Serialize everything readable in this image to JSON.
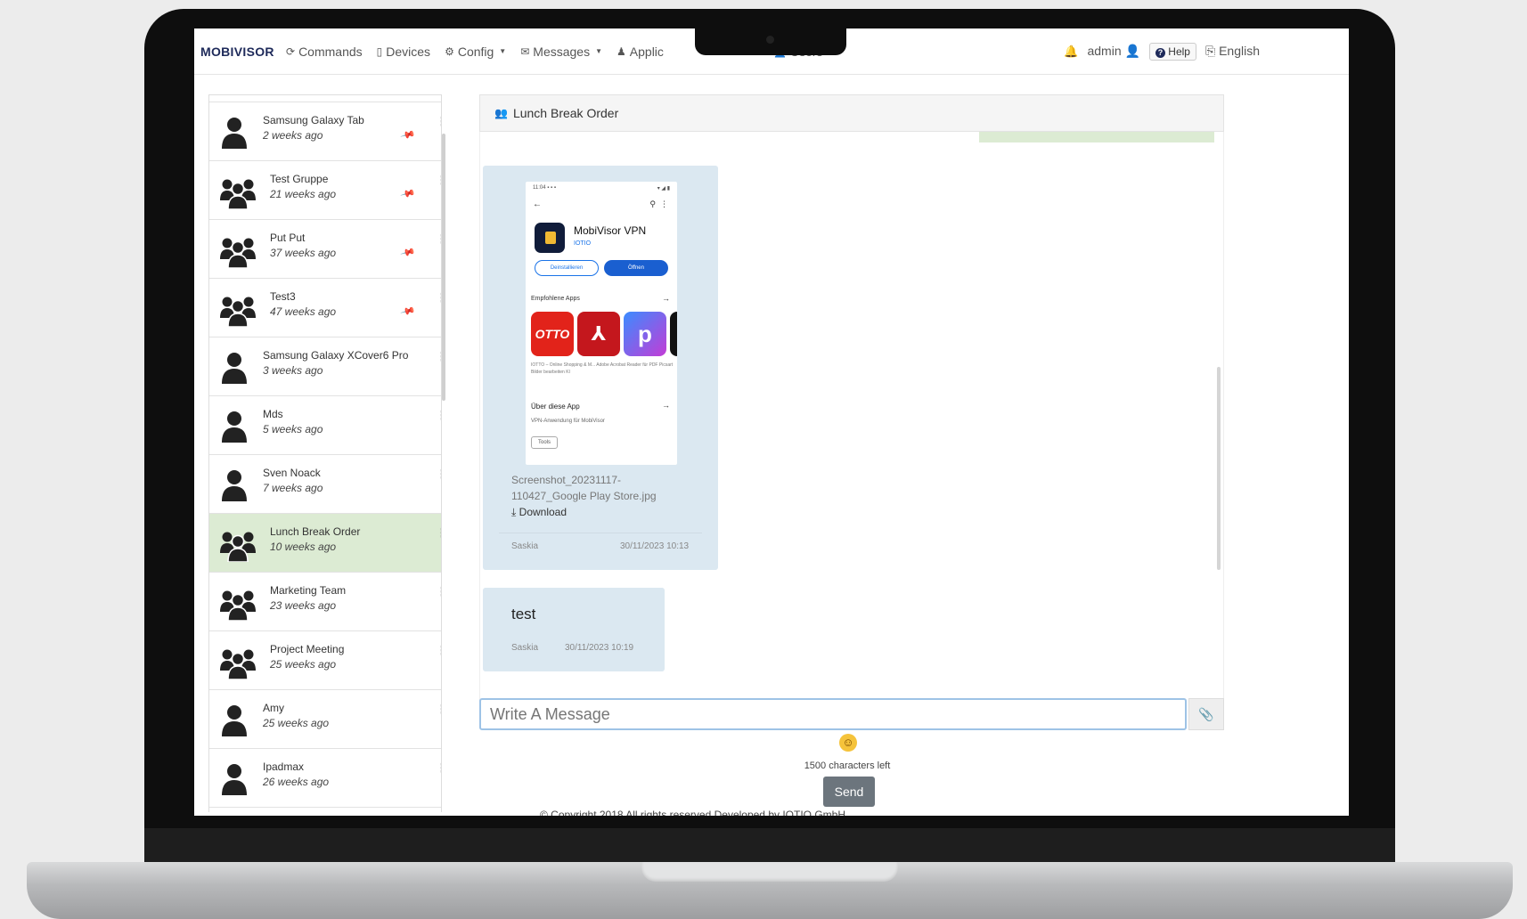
{
  "nav": {
    "brand": "MOBIVISOR",
    "items": [
      {
        "label": "Commands",
        "icon": "refresh-icon",
        "caret": false
      },
      {
        "label": "Devices",
        "icon": "phone-icon",
        "caret": false
      },
      {
        "label": "Config",
        "icon": "gear-icon",
        "caret": true
      },
      {
        "label": "Messages",
        "icon": "envelope-icon",
        "caret": true
      },
      {
        "label": "Applic",
        "icon": "app-icon",
        "caret": false
      },
      {
        "label": "Users",
        "icon": "user-icon",
        "caret": true
      }
    ],
    "admin_label": "admin",
    "help_label": "Help",
    "language_label": "English"
  },
  "conversations": [
    {
      "name": "Samsung Galaxy Tab",
      "time": "2 weeks ago",
      "type": "user",
      "pinned": true,
      "active": false
    },
    {
      "name": "Test Gruppe",
      "time": "21 weeks ago",
      "type": "group",
      "pinned": true,
      "active": false
    },
    {
      "name": "Put Put",
      "time": "37 weeks ago",
      "type": "group",
      "pinned": true,
      "active": false
    },
    {
      "name": "Test3",
      "time": "47 weeks ago",
      "type": "group",
      "pinned": true,
      "active": false
    },
    {
      "name": "Samsung Galaxy XCover6 Pro",
      "time": "3 weeks ago",
      "type": "user",
      "pinned": false,
      "active": false
    },
    {
      "name": "Mds",
      "time": "5 weeks ago",
      "type": "user",
      "pinned": false,
      "active": false
    },
    {
      "name": "Sven Noack",
      "time": "7 weeks ago",
      "type": "user",
      "pinned": false,
      "active": false
    },
    {
      "name": "Lunch Break Order",
      "time": "10 weeks ago",
      "type": "group",
      "pinned": false,
      "active": true
    },
    {
      "name": "Marketing Team",
      "time": "23 weeks ago",
      "type": "group",
      "pinned": false,
      "active": false
    },
    {
      "name": "Project Meeting",
      "time": "25 weeks ago",
      "type": "group",
      "pinned": false,
      "active": false
    },
    {
      "name": "Amy",
      "time": "25 weeks ago",
      "type": "user",
      "pinned": false,
      "active": false
    },
    {
      "name": "Ipadmax",
      "time": "26 weeks ago",
      "type": "user",
      "pinned": false,
      "active": false
    }
  ],
  "chat": {
    "title": "Lunch Break Order",
    "messages": [
      {
        "type": "image",
        "file_name": "Screenshot_20231117-110427_Google Play Store.jpg",
        "download_label": "Download",
        "sender": "Saskia",
        "timestamp": "30/11/2023 10:13"
      },
      {
        "type": "text",
        "text": "test",
        "sender": "Saskia",
        "timestamp": "30/11/2023 10:19"
      }
    ],
    "attachment_preview": {
      "app_title": "MobiVisor VPN",
      "developer": "IOTIO",
      "uninstall_label": "Deinstallieren",
      "open_label": "Öffnen",
      "recommended_label": "Empfohlene Apps",
      "tiles": [
        "OTTO",
        "PDF",
        "p"
      ],
      "tile_captions": "IOTTO – Online Shopping & M...   Adobe Acrobat Reader für PDF   Picsart Bilder bearbeiten KI",
      "about_label": "Über diese App",
      "about_desc": "VPN-Anwendung für MobiVisor",
      "chip_label": "Tools"
    }
  },
  "compose": {
    "placeholder": "Write A Message",
    "chars_left": "1500 characters left",
    "send_label": "Send"
  },
  "footer": {
    "copyright": "© Copyright 2018 All rights reserved Developed by IOTIO GmbH"
  }
}
